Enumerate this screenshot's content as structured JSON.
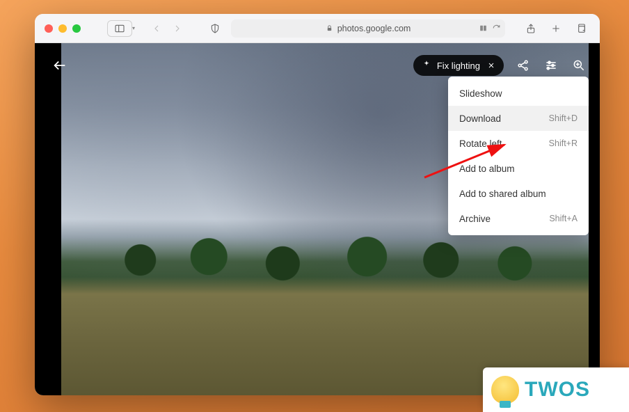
{
  "browser": {
    "url": "photos.google.com"
  },
  "viewer": {
    "suggestion_label": "Fix lighting"
  },
  "menu": {
    "items": [
      {
        "label": "Slideshow",
        "shortcut": ""
      },
      {
        "label": "Download",
        "shortcut": "Shift+D"
      },
      {
        "label": "Rotate left",
        "shortcut": "Shift+R"
      },
      {
        "label": "Add to album",
        "shortcut": ""
      },
      {
        "label": "Add to shared album",
        "shortcut": ""
      },
      {
        "label": "Archive",
        "shortcut": "Shift+A"
      }
    ],
    "highlighted_index": 1
  },
  "badge": {
    "text": "TWOS"
  }
}
